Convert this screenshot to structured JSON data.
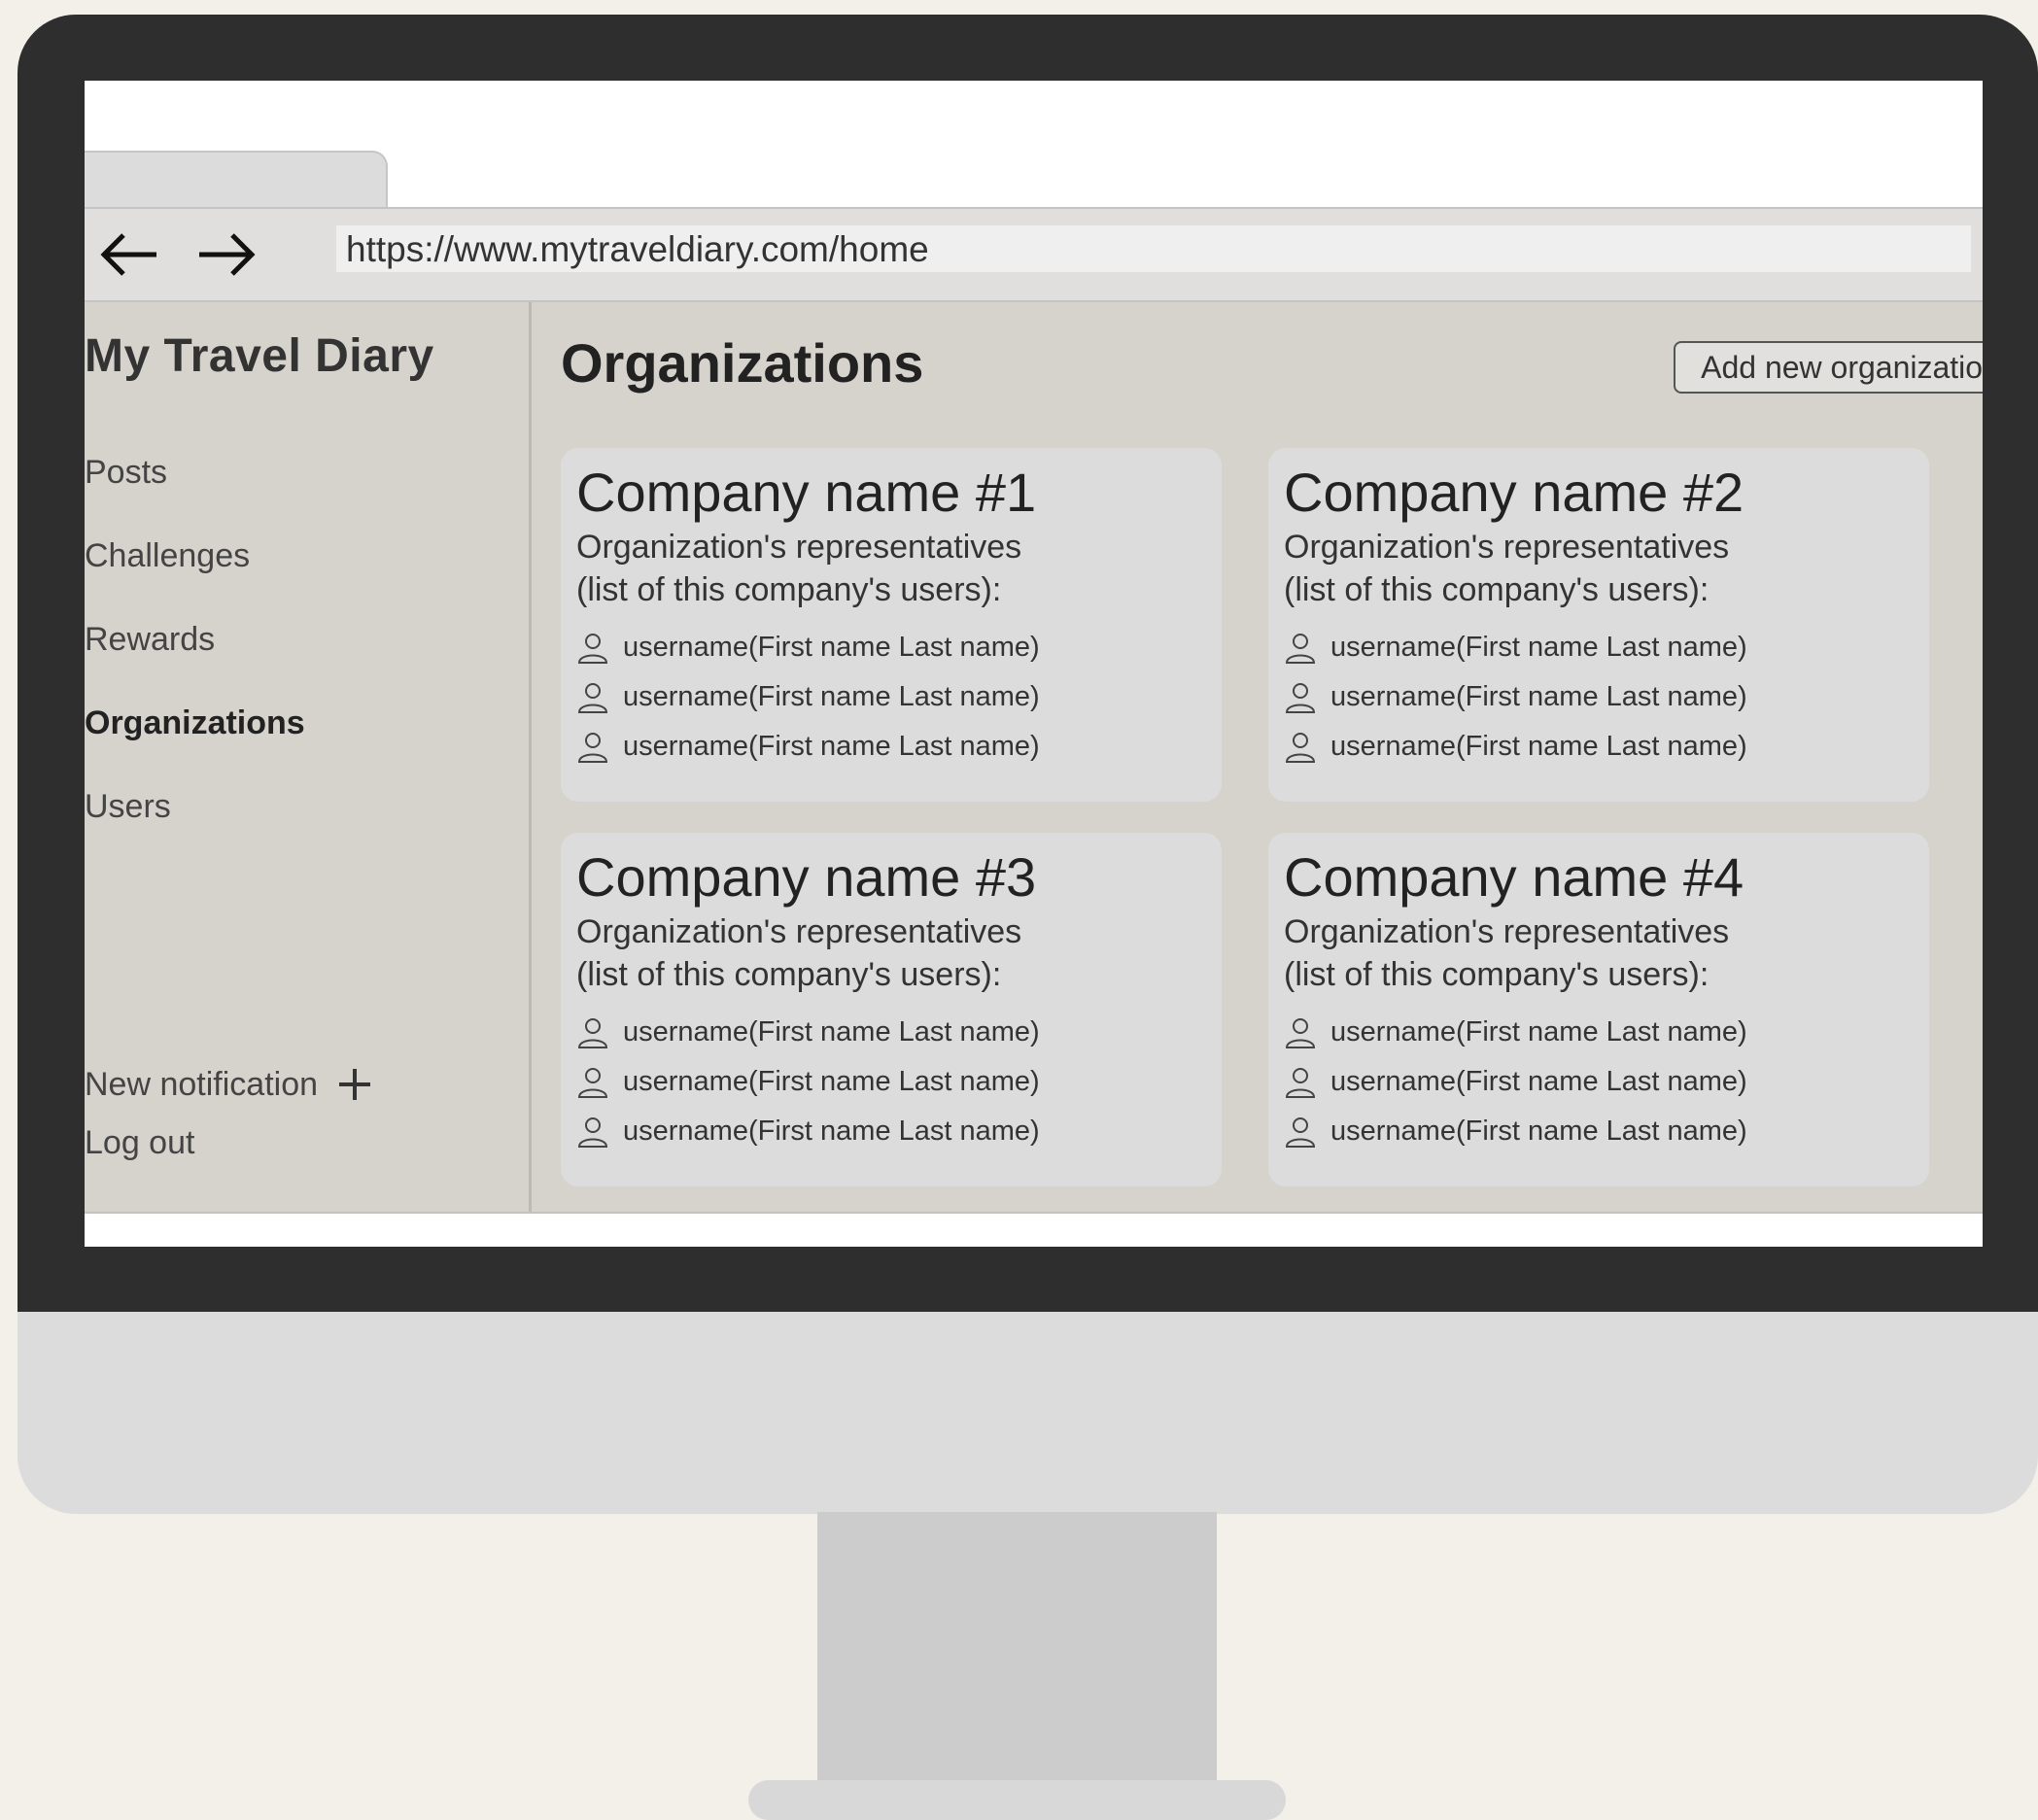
{
  "browser": {
    "url": "https://www.mytraveldiary.com/home"
  },
  "sidebar": {
    "brand": "My Travel Diary",
    "items": [
      {
        "label": "Posts"
      },
      {
        "label": "Challenges"
      },
      {
        "label": "Rewards"
      },
      {
        "label": "Organizations",
        "active": true
      },
      {
        "label": "Users"
      }
    ],
    "new_notification": "New notification",
    "logout": "Log out"
  },
  "main": {
    "title": "Organizations",
    "add_button": "Add new organization",
    "organizations": [
      {
        "name": "Company name #1",
        "subtitle_line1": "Organization's representatives",
        "subtitle_line2": "(list of this company's users):",
        "representatives": [
          "username(First name Last name)",
          "username(First name Last name)",
          "username(First name Last name)"
        ]
      },
      {
        "name": "Company name #2",
        "subtitle_line1": "Organization's representatives",
        "subtitle_line2": "(list of this company's users):",
        "representatives": [
          "username(First name Last name)",
          "username(First name Last name)",
          "username(First name Last name)"
        ]
      },
      {
        "name": "Company name #3",
        "subtitle_line1": "Organization's representatives",
        "subtitle_line2": "(list of this company's users):",
        "representatives": [
          "username(First name Last name)",
          "username(First name Last name)",
          "username(First name Last name)"
        ]
      },
      {
        "name": "Company name #4",
        "subtitle_line1": "Organization's representatives",
        "subtitle_line2": "(list of this company's users):",
        "representatives": [
          "username(First name Last name)",
          "username(First name Last name)",
          "username(First name Last name)"
        ]
      }
    ]
  },
  "icons": {
    "back": "arrow-left-icon",
    "forward": "arrow-right-icon",
    "plus": "plus-icon",
    "user": "user-icon"
  },
  "colors": {
    "app_background": "#d6d3cd",
    "card_background": "#dcdcdc",
    "bezel": "#2e2e2e"
  }
}
